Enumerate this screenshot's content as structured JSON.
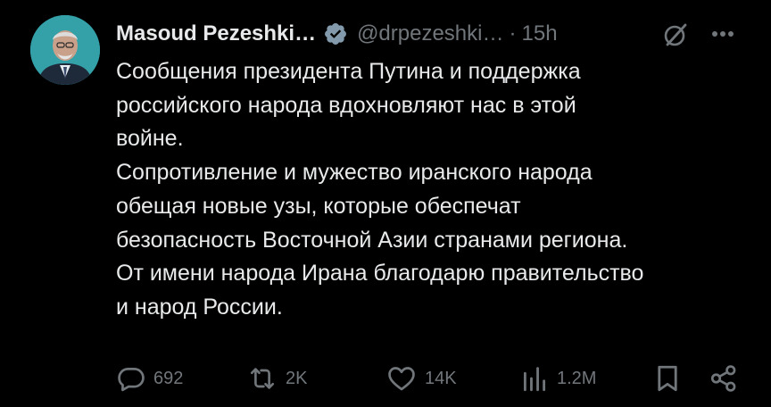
{
  "author": {
    "name": "Masoud Pezeshki…",
    "handle": "@drpezeshki…",
    "separator": "·",
    "time": "15h",
    "verified_icon": "verified-badge-icon"
  },
  "tweet": {
    "lines": [
      "Сообщения президента Путина и поддержка",
      "российского народа вдохновляют нас в этой",
      "войне.",
      "Сопротивление и мужество иранского народа",
      "обещая новые узы, которые обеспечат",
      "безопасность Восточной Азии странами региона.",
      "От имени народа Ирана благодарю правительство",
      "и народ России."
    ]
  },
  "actions": {
    "replies": "692",
    "reposts": "2K",
    "likes": "14K",
    "views": "1.2M"
  },
  "colors": {
    "background": "#000000",
    "text": "#e7e9ea",
    "muted": "#71767b",
    "verified": "#829aab"
  }
}
